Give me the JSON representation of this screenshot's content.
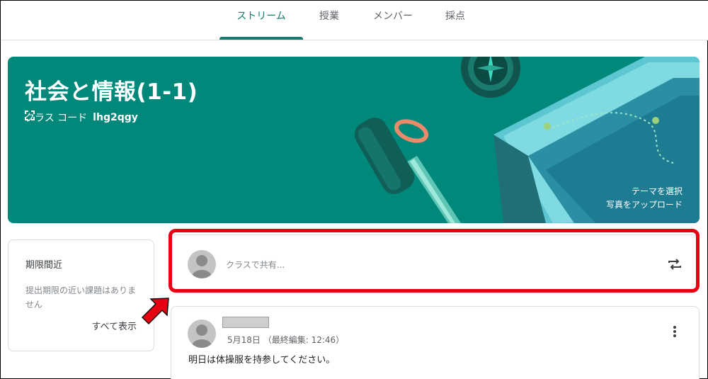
{
  "tabs": [
    {
      "label": "ストリーム",
      "active": true
    },
    {
      "label": "授業"
    },
    {
      "label": "メンバー"
    },
    {
      "label": "採点"
    }
  ],
  "banner": {
    "title": "社会と情報(1-1)",
    "class_code_label": "クラス コード",
    "class_code": "lhg2qgy",
    "select_theme": "テーマを選択",
    "upload_photo": "写真をアップロード",
    "color": "#00897b"
  },
  "upcoming": {
    "title": "期限間近",
    "empty_text": "提出期限の近い課題はありません",
    "view_all": "すべて表示"
  },
  "share": {
    "placeholder": "クラスで共有..."
  },
  "post": {
    "date": "5月18日 （最終編集: 12:46）",
    "body": "明日は体操服を持参してください。"
  },
  "colors": {
    "accent": "#137c6e",
    "highlight": "#e60012"
  },
  "icons": {
    "expand": "fullscreen-icon",
    "repost": "repost-icon",
    "more": "more-vert-icon"
  }
}
